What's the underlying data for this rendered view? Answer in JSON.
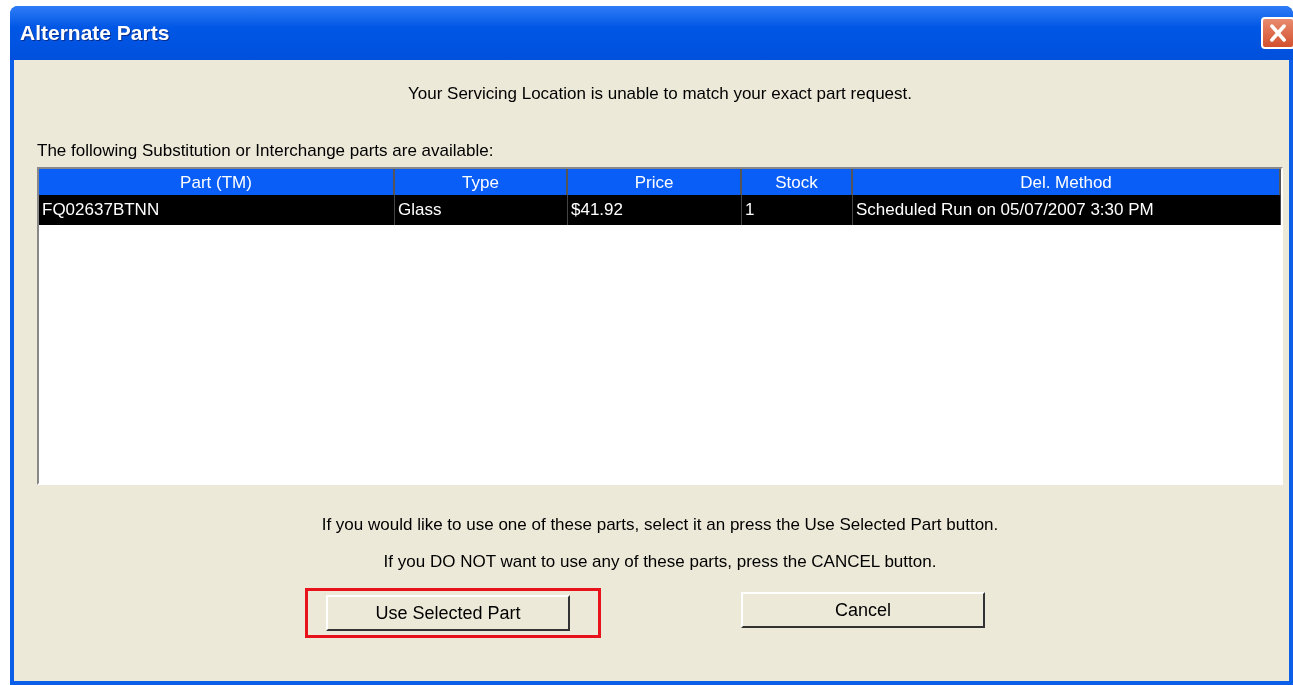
{
  "window": {
    "title": "Alternate Parts"
  },
  "message": "Your Servicing Location is unable to match your exact part request.",
  "list_caption": "The following Substitution or Interchange parts are available:",
  "table": {
    "columns": [
      "Part (TM)",
      "Type",
      "Price",
      "Stock",
      "Del. Method"
    ],
    "rows": [
      {
        "cells": [
          "FQ02637BTNN",
          "Glass",
          "$41.92",
          "1",
          "Scheduled Run on 05/07/2007 3:30 PM"
        ],
        "selected": true
      }
    ]
  },
  "instructions": [
    "If you would like to use one of these parts, select it an press the Use Selected Part button.",
    "If you DO NOT want to use any of these parts, press the CANCEL button."
  ],
  "buttons": [
    {
      "label": "Use Selected Part",
      "highlighted": true
    },
    {
      "label": "Cancel",
      "highlighted": false
    }
  ]
}
